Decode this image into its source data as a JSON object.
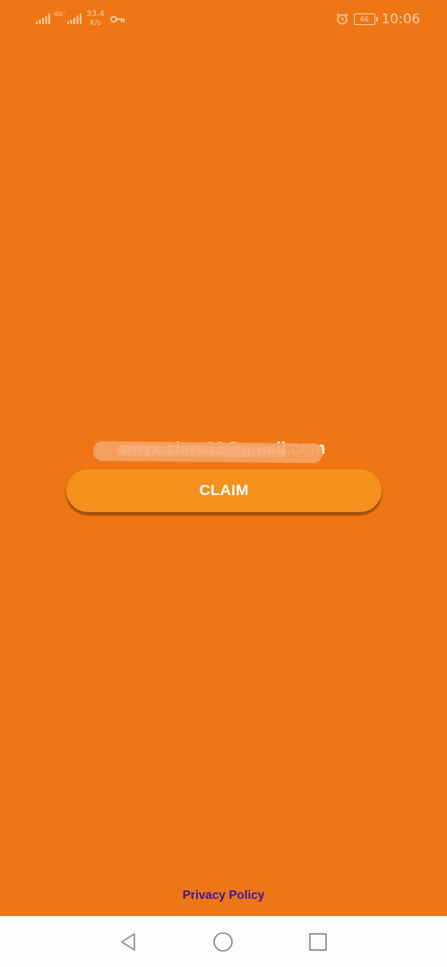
{
  "theme": {
    "background": "#ee7615",
    "button_color": "#f5901c",
    "link_color": "#3a17a0",
    "navbar_bg": "#fcfcfc"
  },
  "status_bar": {
    "network_gen": "4G⁺",
    "speed_value": "33.4",
    "speed_unit": "K/s",
    "battery_level": "46",
    "time": "10:06",
    "icons": [
      "signal-icon",
      "signal-icon",
      "vpn-key-icon",
      "alarm-icon",
      "battery-icon"
    ]
  },
  "main": {
    "email_visible": "onyx.ciara32@gmail.com",
    "claim_label": "CLAIM"
  },
  "footer": {
    "privacy_label": "Privacy Policy"
  },
  "nav_bar": {
    "icons": [
      "back-icon",
      "home-icon",
      "recents-icon"
    ]
  }
}
